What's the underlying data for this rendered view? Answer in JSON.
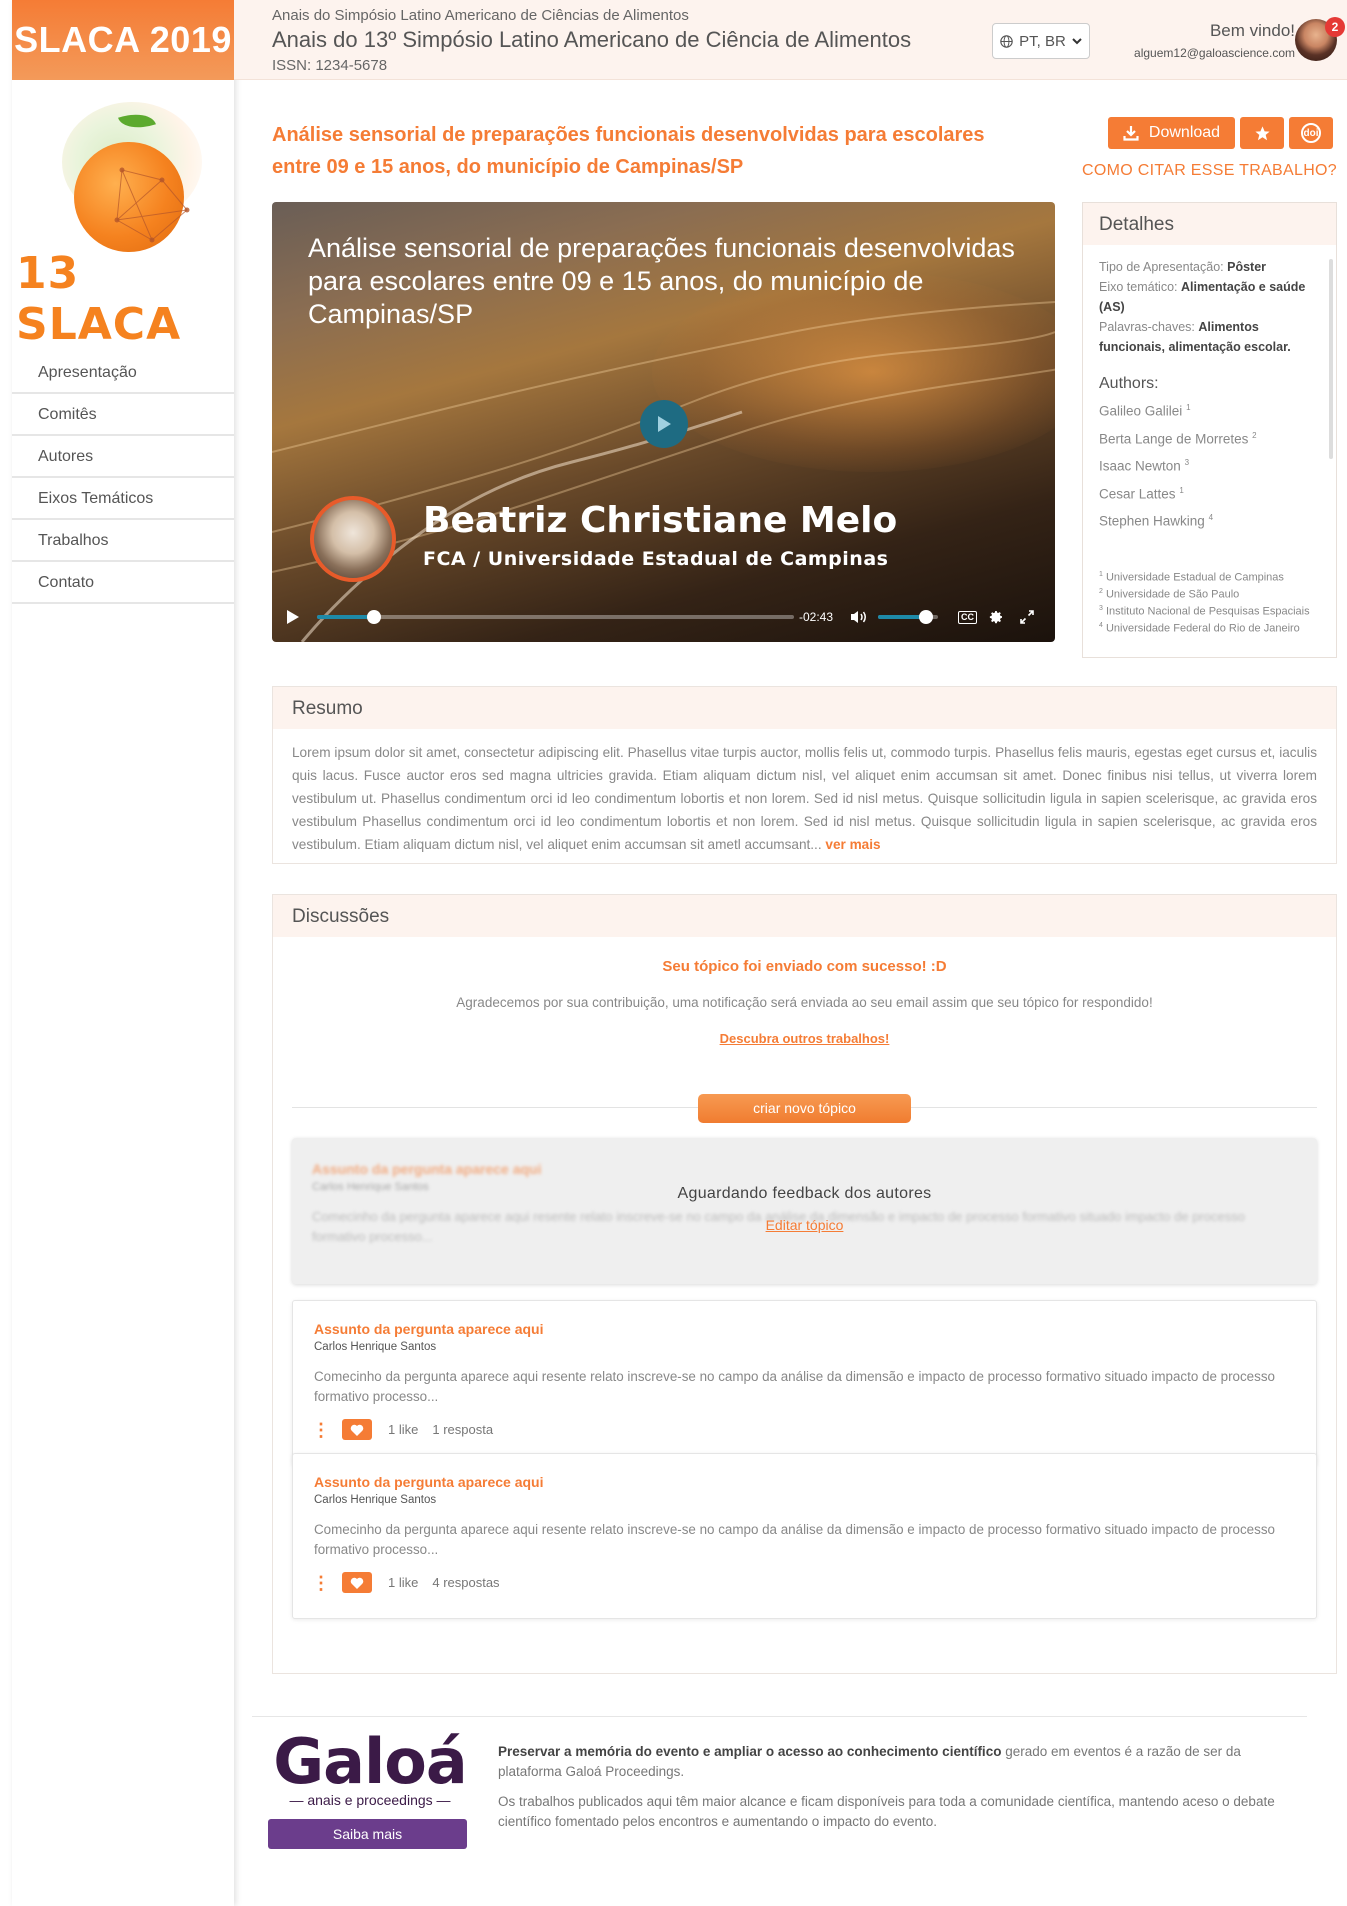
{
  "brand": {
    "label": "SLACA 2019"
  },
  "event_logo": {
    "name": "13 SLACA"
  },
  "nav": {
    "items": [
      {
        "label": "Apresentação"
      },
      {
        "label": "Comitês"
      },
      {
        "label": "Autores"
      },
      {
        "label": "Eixos Temáticos"
      },
      {
        "label": "Trabalhos"
      },
      {
        "label": "Contato"
      }
    ]
  },
  "header": {
    "kicker": "Anais do Simpósio Latino Americano de Ciências de Alimentos",
    "title": "Anais do 13º Simpósio Latino Americano de Ciência de Alimentos",
    "issn": "ISSN: 1234-5678",
    "language": "PT, BR",
    "greeting": "Bem vindo!",
    "email": "alguem12@galoascience.com",
    "notifications": "2"
  },
  "article": {
    "title": "Análise sensorial de preparações funcionais desenvolvidas para escolares entre 09 e 15 anos, do município de Campinas/SP",
    "download_label": "Download",
    "doi_label": "doi",
    "cite_label": "COMO CITAR ESSE TRABALHO?"
  },
  "video": {
    "title": "Análise sensorial de preparações funcionais desenvolvidas para escolares entre 09 e 15 anos, do município de Campinas/SP",
    "presenter": "Beatriz Christiane Melo",
    "institution": "FCA / Universidade Estadual de Campinas",
    "time_remaining": "-02:43",
    "progress": 0.12,
    "volume": 0.8,
    "cc_label": "CC"
  },
  "details": {
    "heading": "Detalhes",
    "type_label": "Tipo de Apresentação:",
    "type_value": "Pôster",
    "axis_label": "Eixo temático:",
    "axis_value": "Alimentação e saúde (AS)",
    "keywords_label": "Palavras-chaves:",
    "keywords_value": "Alimentos funcionais, alimentação escolar.",
    "authors_title": "Authors:",
    "authors": [
      {
        "name": "Galileo Galilei",
        "aff": "1"
      },
      {
        "name": "Berta Lange de Morretes",
        "aff": "2"
      },
      {
        "name": "Isaac Newton",
        "aff": "3"
      },
      {
        "name": "Cesar Lattes",
        "aff": "1"
      },
      {
        "name": "Stephen Hawking",
        "aff": "4"
      }
    ],
    "affiliations": [
      {
        "n": "1",
        "name": "Universidade Estadual de Campinas"
      },
      {
        "n": "2",
        "name": "Universidade de São Paulo"
      },
      {
        "n": "3",
        "name": "Instituto Nacional de Pesquisas Espaciais"
      },
      {
        "n": "4",
        "name": "Universidade Federal do Rio de Janeiro"
      }
    ]
  },
  "resumo": {
    "heading": "Resumo",
    "text": "Lorem ipsum dolor sit amet, consectetur adipiscing elit. Phasellus vitae turpis auctor, mollis felis ut, commodo turpis. Phasellus felis mauris, egestas eget cursus et, iaculis quis lacus. Fusce auctor eros sed magna ultricies gravida. Etiam aliquam dictum nisl, vel aliquet enim accumsan sit amet. Donec finibus nisi tellus, ut viverra lorem vestibulum ut. Phasellus condimentum orci id leo condimentum lobortis et non lorem. Sed id nisl metus. Quisque sollicitudin ligula in sapien scelerisque, ac gravida eros vestibulum Phasellus condimentum orci id leo condimentum lobortis et non lorem. Sed id nisl metus. Quisque sollicitudin ligula in sapien scelerisque, ac gravida eros vestibulum. Etiam aliquam dictum nisl, vel aliquet enim accumsan sit ametl accumsant...",
    "more_label": "ver mais"
  },
  "discussions": {
    "heading": "Discussões",
    "success_title": "Seu tópico foi enviado com sucesso! :D",
    "success_msg": "Agradecemos por sua contribuição, uma notificação será enviada ao seu email assim que seu tópico for respondido!",
    "discover_label": "Descubra outros trabalhos!",
    "new_topic_label": "criar novo tópico",
    "pending": {
      "title": "Assunto da pergunta aparece aqui",
      "author": "Carlos Henrique Santos",
      "excerpt": "Comecinho da pergunta aparece aqui resente relato inscreve-se no campo da análise da dimensão e impacto de processo formativo situado impacto de processo formativo processo...",
      "status": "Aguardando feedback dos autores",
      "edit_label": "Editar tópico"
    },
    "topics": [
      {
        "title": "Assunto da pergunta aparece aqui",
        "author": "Carlos Henrique Santos",
        "excerpt": "Comecinho da pergunta aparece aqui resente relato inscreve-se no campo da análise da dimensão e impacto de processo formativo situado impacto de processo formativo processo...",
        "likes": "1 like",
        "replies": "1 resposta"
      },
      {
        "title": "Assunto da pergunta aparece aqui",
        "author": "Carlos Henrique Santos",
        "excerpt": "Comecinho da pergunta aparece aqui resente relato inscreve-se no campo da análise da dimensão e impacto de processo formativo situado impacto de processo formativo processo...",
        "likes": "1 like",
        "replies": "4 respostas"
      }
    ]
  },
  "footer": {
    "logo_word": "Galoá",
    "logo_sub": "anais e proceedings",
    "saiba_label": "Saiba mais",
    "p1_bold": "Preservar a memória do evento e ampliar o acesso ao conhecimento científico",
    "p1_rest": " gerado em eventos é a razão de ser da plataforma Galoá Proceedings.",
    "p2": "Os trabalhos publicados aqui têm maior alcance e ficam disponíveis para toda a comunidade científica, mantendo aceso o debate científico fomentado pelos encontros e aumentando o impacto do evento."
  },
  "colors": {
    "accent": "#f57c35",
    "header_bg": "#fdf3ee",
    "galoa_purple": "#6b3d8c",
    "player_blue": "#1e8aa8"
  }
}
